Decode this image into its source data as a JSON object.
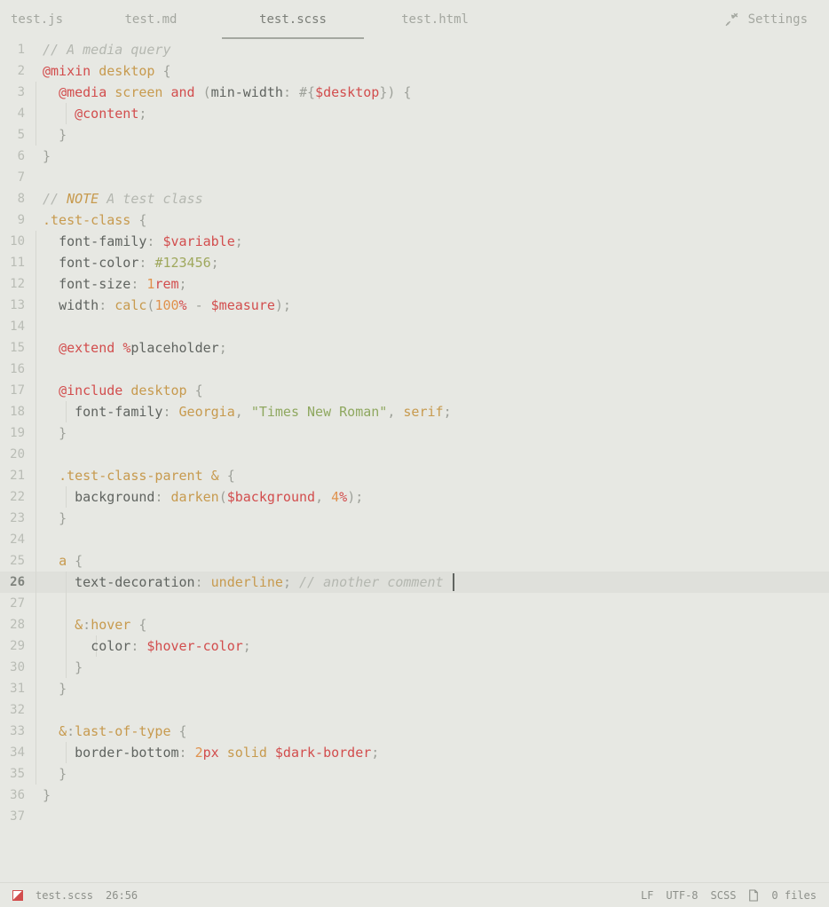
{
  "tabs": {
    "items": [
      "test.js",
      "test.md",
      "test.scss",
      "test.html"
    ],
    "active_index": 2,
    "settings_label": "Settings"
  },
  "editor": {
    "cursor_line": 26,
    "lines": [
      {
        "n": 1,
        "indent": 0,
        "tokens": [
          [
            "cm",
            "// A media query"
          ]
        ]
      },
      {
        "n": 2,
        "indent": 0,
        "tokens": [
          [
            "kw",
            "@mixin"
          ],
          [
            "punc",
            " "
          ],
          [
            "fn",
            "desktop"
          ],
          [
            "punc",
            " {"
          ]
        ]
      },
      {
        "n": 3,
        "indent": 1,
        "tokens": [
          [
            "kw",
            "@media"
          ],
          [
            "punc",
            " "
          ],
          [
            "fn",
            "screen"
          ],
          [
            "punc",
            " "
          ],
          [
            "kw2",
            "and"
          ],
          [
            "punc",
            " ("
          ],
          [
            "prop",
            "min-width"
          ],
          [
            "punc",
            ": #{"
          ],
          [
            "var",
            "$desktop"
          ],
          [
            "punc",
            "}) {"
          ]
        ]
      },
      {
        "n": 4,
        "indent": 2,
        "tokens": [
          [
            "kw",
            "@content"
          ],
          [
            "punc",
            ";"
          ]
        ]
      },
      {
        "n": 5,
        "indent": 1,
        "tokens": [
          [
            "punc",
            "}"
          ]
        ]
      },
      {
        "n": 6,
        "indent": 0,
        "tokens": [
          [
            "punc",
            "}"
          ]
        ]
      },
      {
        "n": 7,
        "indent": 0,
        "tokens": []
      },
      {
        "n": 8,
        "indent": 0,
        "tokens": [
          [
            "cm",
            "// "
          ],
          [
            "note",
            "NOTE"
          ],
          [
            "cm",
            " A test class"
          ]
        ]
      },
      {
        "n": 9,
        "indent": 0,
        "tokens": [
          [
            "sel",
            ".test-class"
          ],
          [
            "punc",
            " {"
          ]
        ]
      },
      {
        "n": 10,
        "indent": 1,
        "tokens": [
          [
            "prop",
            "font-family"
          ],
          [
            "punc",
            ": "
          ],
          [
            "var",
            "$variable"
          ],
          [
            "punc",
            ";"
          ]
        ]
      },
      {
        "n": 11,
        "indent": 1,
        "tokens": [
          [
            "prop",
            "font-color"
          ],
          [
            "punc",
            ": "
          ],
          [
            "hex",
            "#123456"
          ],
          [
            "punc",
            ";"
          ]
        ]
      },
      {
        "n": 12,
        "indent": 1,
        "tokens": [
          [
            "prop",
            "font-size"
          ],
          [
            "punc",
            ": "
          ],
          [
            "num",
            "1"
          ],
          [
            "unit",
            "rem"
          ],
          [
            "punc",
            ";"
          ]
        ]
      },
      {
        "n": 13,
        "indent": 1,
        "tokens": [
          [
            "prop",
            "width"
          ],
          [
            "punc",
            ": "
          ],
          [
            "fn",
            "calc"
          ],
          [
            "punc",
            "("
          ],
          [
            "num",
            "100"
          ],
          [
            "unit",
            "%"
          ],
          [
            "punc",
            " - "
          ],
          [
            "var",
            "$measure"
          ],
          [
            "punc",
            ");"
          ]
        ]
      },
      {
        "n": 14,
        "indent": 1,
        "tokens": []
      },
      {
        "n": 15,
        "indent": 1,
        "tokens": [
          [
            "kw",
            "@extend"
          ],
          [
            "punc",
            " "
          ],
          [
            "unit",
            "%"
          ],
          [
            "pc",
            "placeholder"
          ],
          [
            "punc",
            ";"
          ]
        ]
      },
      {
        "n": 16,
        "indent": 1,
        "tokens": []
      },
      {
        "n": 17,
        "indent": 1,
        "tokens": [
          [
            "kw",
            "@include"
          ],
          [
            "punc",
            " "
          ],
          [
            "fn",
            "desktop"
          ],
          [
            "punc",
            " {"
          ]
        ]
      },
      {
        "n": 18,
        "indent": 2,
        "tokens": [
          [
            "prop",
            "font-family"
          ],
          [
            "punc",
            ": "
          ],
          [
            "fn",
            "Georgia"
          ],
          [
            "punc",
            ", "
          ],
          [
            "str",
            "\"Times New Roman\""
          ],
          [
            "punc",
            ", "
          ],
          [
            "fn",
            "serif"
          ],
          [
            "punc",
            ";"
          ]
        ]
      },
      {
        "n": 19,
        "indent": 1,
        "tokens": [
          [
            "punc",
            "}"
          ]
        ]
      },
      {
        "n": 20,
        "indent": 1,
        "tokens": []
      },
      {
        "n": 21,
        "indent": 1,
        "tokens": [
          [
            "sel",
            ".test-class-parent &"
          ],
          [
            "punc",
            " {"
          ]
        ]
      },
      {
        "n": 22,
        "indent": 2,
        "tokens": [
          [
            "prop",
            "background"
          ],
          [
            "punc",
            ": "
          ],
          [
            "fn",
            "darken"
          ],
          [
            "punc",
            "("
          ],
          [
            "var",
            "$background"
          ],
          [
            "punc",
            ", "
          ],
          [
            "num",
            "4"
          ],
          [
            "unit",
            "%"
          ],
          [
            "punc",
            ");"
          ]
        ]
      },
      {
        "n": 23,
        "indent": 1,
        "tokens": [
          [
            "punc",
            "}"
          ]
        ]
      },
      {
        "n": 24,
        "indent": 1,
        "tokens": []
      },
      {
        "n": 25,
        "indent": 1,
        "tokens": [
          [
            "sel",
            "a"
          ],
          [
            "punc",
            " {"
          ]
        ]
      },
      {
        "n": 26,
        "indent": 2,
        "tokens": [
          [
            "prop",
            "text-decoration"
          ],
          [
            "punc",
            ": "
          ],
          [
            "val",
            "underline"
          ],
          [
            "punc",
            "; "
          ],
          [
            "cm",
            "// another comment"
          ]
        ]
      },
      {
        "n": 27,
        "indent": 2,
        "tokens": []
      },
      {
        "n": 28,
        "indent": 2,
        "tokens": [
          [
            "sel",
            "&"
          ],
          [
            "punc",
            ":"
          ],
          [
            "ps",
            "hover"
          ],
          [
            "punc",
            " {"
          ]
        ]
      },
      {
        "n": 29,
        "indent": 3,
        "tokens": [
          [
            "prop",
            "color"
          ],
          [
            "punc",
            ": "
          ],
          [
            "var",
            "$hover-color"
          ],
          [
            "punc",
            ";"
          ]
        ]
      },
      {
        "n": 30,
        "indent": 2,
        "tokens": [
          [
            "punc",
            "}"
          ]
        ]
      },
      {
        "n": 31,
        "indent": 1,
        "tokens": [
          [
            "punc",
            "}"
          ]
        ]
      },
      {
        "n": 32,
        "indent": 1,
        "tokens": []
      },
      {
        "n": 33,
        "indent": 1,
        "tokens": [
          [
            "sel",
            "&"
          ],
          [
            "punc",
            ":"
          ],
          [
            "ps",
            "last-of-type"
          ],
          [
            "punc",
            " {"
          ]
        ]
      },
      {
        "n": 34,
        "indent": 2,
        "tokens": [
          [
            "prop",
            "border-bottom"
          ],
          [
            "punc",
            ": "
          ],
          [
            "num",
            "2"
          ],
          [
            "unit",
            "px"
          ],
          [
            "punc",
            " "
          ],
          [
            "val",
            "solid"
          ],
          [
            "punc",
            " "
          ],
          [
            "var",
            "$dark-border"
          ],
          [
            "punc",
            ";"
          ]
        ]
      },
      {
        "n": 35,
        "indent": 1,
        "tokens": [
          [
            "punc",
            "}"
          ]
        ]
      },
      {
        "n": 36,
        "indent": 0,
        "tokens": [
          [
            "punc",
            "}"
          ]
        ]
      },
      {
        "n": 37,
        "indent": 0,
        "tokens": []
      }
    ]
  },
  "status": {
    "filename": "test.scss",
    "position": "26:56",
    "line_ending": "LF",
    "encoding": "UTF-8",
    "language": "SCSS",
    "files": "0 files"
  }
}
